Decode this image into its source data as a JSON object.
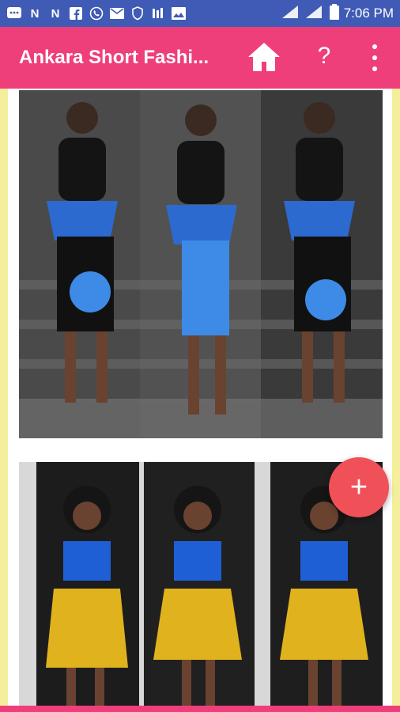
{
  "statusbar": {
    "time": "7:06 PM"
  },
  "appbar": {
    "title": "Ankara Short Fashi..."
  },
  "fab": {
    "label": "+"
  },
  "icons": {
    "home": "home-icon",
    "help": "help-icon",
    "menu": "more-vert-icon"
  },
  "colors": {
    "statusbar": "#3f5bb5",
    "appbar": "#ee3f7a",
    "fab": "#f05058",
    "background": "#f3ef9a"
  }
}
